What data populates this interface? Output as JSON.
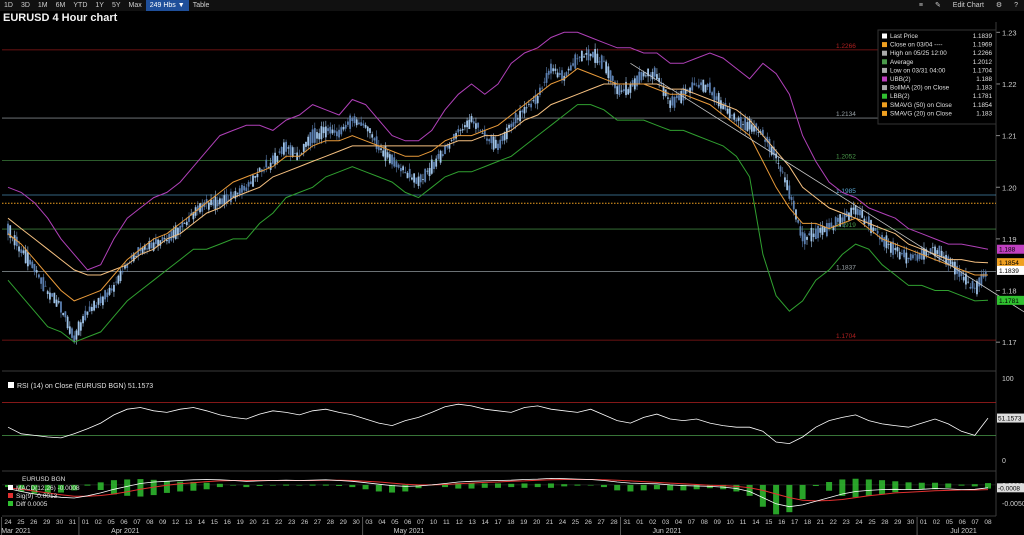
{
  "toolbar": {
    "ranges": [
      "1D",
      "3D",
      "1M",
      "6M",
      "YTD",
      "1Y",
      "5Y",
      "Max"
    ],
    "active_range": "249 Hbs ▼",
    "table_label": "Table",
    "edit_chart_label": "Edit Chart"
  },
  "chart_title": "EURUSD 4 Hour chart",
  "chart_data": [
    {
      "type": "line",
      "subtype": "candlestick-with-bollinger-bands",
      "title": "EURUSD 4 Hour chart",
      "ylim": [
        1.165,
        1.232
      ],
      "y_ticks": [
        "1.23",
        "1.22",
        "1.21",
        "1.20",
        "1.19",
        "1.18",
        "1.17"
      ],
      "x_date_labels": [
        "24",
        "25",
        "26",
        "29",
        "30",
        "31",
        "01",
        "02",
        "05",
        "06",
        "07",
        "08",
        "09",
        "12",
        "13",
        "14",
        "15",
        "16",
        "19",
        "20",
        "21",
        "22",
        "23",
        "26",
        "27",
        "28",
        "29",
        "30",
        "03",
        "04",
        "05",
        "06",
        "07",
        "10",
        "11",
        "12",
        "13",
        "14",
        "17",
        "18",
        "19",
        "20",
        "21",
        "24",
        "25",
        "26",
        "27",
        "28",
        "31",
        "01",
        "02",
        "03",
        "04",
        "07",
        "08",
        "09",
        "10",
        "11",
        "14",
        "15",
        "16",
        "17",
        "18",
        "21",
        "22",
        "23",
        "24",
        "25",
        "28",
        "29",
        "30",
        "01",
        "02",
        "05",
        "06",
        "07",
        "08"
      ],
      "x_month_labels": [
        "Mar 2021",
        "Apr 2021",
        "May 2021",
        "Jun 2021",
        "Jul 2021"
      ],
      "horizontal_levels": [
        {
          "value": 1.2266,
          "label": "1.2266",
          "color": "#b02020"
        },
        {
          "value": 1.2134,
          "label": "1.2134",
          "color": "#9aa3a8"
        },
        {
          "value": 1.2052,
          "label": "1.2052",
          "color": "#4a9a4a"
        },
        {
          "value": 1.1985,
          "label": "1.1985",
          "color": "#5aaad8"
        },
        {
          "value": 1.1919,
          "label": "1.1919",
          "color": "#4a9a4a"
        },
        {
          "value": 1.1837,
          "label": "1.1837",
          "color": "#9aa3a8"
        },
        {
          "value": 1.1704,
          "label": "1.1704",
          "color": "#b02020"
        }
      ],
      "dotted_level": {
        "value": 1.1969,
        "color": "#f0a020"
      },
      "trendline": {
        "from": [
          "16",
          1.224
        ],
        "to": [
          "08",
          1.1705
        ],
        "color": "#c8c8c8"
      },
      "legend": [
        {
          "label": "Last Price",
          "value": "1.1839",
          "color": "#ffffff"
        },
        {
          "label": "Close on 03/04 ----",
          "value": "1.1969",
          "color": "#f0a020"
        },
        {
          "label": "High on 05/25 12:00",
          "value": "1.2266",
          "color": "#aaaaaa"
        },
        {
          "label": "Average",
          "value": "1.2012",
          "color": "#4a9a4a"
        },
        {
          "label": "Low on 03/31 04:00",
          "value": "1.1704",
          "color": "#aaaaaa"
        },
        {
          "label": "UBB(2)",
          "value": "1.188",
          "color": "#c040c0"
        },
        {
          "label": "BollMA (20)  on Close",
          "value": "1.183",
          "color": "#aaaaaa"
        },
        {
          "label": "LBB(2)",
          "value": "1.1781",
          "color": "#30c030"
        },
        {
          "label": "SMAVG (50)  on Close",
          "value": "1.1854",
          "color": "#f0a020"
        },
        {
          "label": "SMAVG (20)  on Close",
          "value": "1.183",
          "color": "#f0a020"
        }
      ],
      "price_tags": [
        {
          "value": 1.188,
          "text": "1.188",
          "color": "#c040c0"
        },
        {
          "value": 1.1854,
          "text": "1.1854",
          "color": "#f0a020"
        },
        {
          "value": 1.1839,
          "text": "1.1839",
          "color": "#ffffff"
        },
        {
          "value": 1.1781,
          "text": "1.1781",
          "color": "#30c030"
        }
      ],
      "series": [
        {
          "name": "Last Price",
          "values": [
            1.192,
            1.188,
            1.184,
            1.18,
            1.177,
            1.171,
            1.176,
            1.178,
            1.181,
            1.185,
            1.188,
            1.189,
            1.19,
            1.192,
            1.195,
            1.197,
            1.197,
            1.198,
            1.2,
            1.203,
            1.205,
            1.208,
            1.206,
            1.21,
            1.211,
            1.21,
            1.213,
            1.212,
            1.208,
            1.205,
            1.203,
            1.201,
            1.204,
            1.207,
            1.211,
            1.213,
            1.21,
            1.208,
            1.212,
            1.215,
            1.217,
            1.223,
            1.221,
            1.225,
            1.226,
            1.224,
            1.219,
            1.219,
            1.222,
            1.222,
            1.216,
            1.218,
            1.22,
            1.219,
            1.216,
            1.213,
            1.212,
            1.21,
            1.206,
            1.199,
            1.19,
            1.191,
            1.192,
            1.194,
            1.196,
            1.193,
            1.19,
            1.188,
            1.186,
            1.187,
            1.188,
            1.186,
            1.183,
            1.18,
            1.1839
          ]
        },
        {
          "name": "SMAVG (20)  on Close",
          "values": [
            1.191,
            1.189,
            1.186,
            1.183,
            1.18,
            1.178,
            1.179,
            1.18,
            1.183,
            1.186,
            1.188,
            1.19,
            1.191,
            1.193,
            1.195,
            1.197,
            1.199,
            1.201,
            1.202,
            1.203,
            1.204,
            1.206,
            1.206,
            1.208,
            1.209,
            1.209,
            1.21,
            1.209,
            1.208,
            1.207,
            1.206,
            1.206,
            1.207,
            1.209,
            1.21,
            1.21,
            1.211,
            1.212,
            1.214,
            1.216,
            1.218,
            1.22,
            1.221,
            1.223,
            1.222,
            1.221,
            1.22,
            1.22,
            1.22,
            1.219,
            1.218,
            1.218,
            1.217,
            1.216,
            1.214,
            1.212,
            1.21,
            1.205,
            1.2,
            1.196,
            1.193,
            1.193,
            1.192,
            1.193,
            1.194,
            1.192,
            1.19,
            1.189,
            1.188,
            1.187,
            1.186,
            1.185,
            1.184,
            1.183,
            1.183
          ]
        },
        {
          "name": "SMAVG (50)  on Close",
          "values": [
            1.194,
            1.192,
            1.19,
            1.188,
            1.186,
            1.184,
            1.183,
            1.183,
            1.184,
            1.185,
            1.187,
            1.188,
            1.19,
            1.191,
            1.193,
            1.195,
            1.196,
            1.198,
            1.199,
            1.2,
            1.202,
            1.203,
            1.204,
            1.205,
            1.206,
            1.207,
            1.208,
            1.208,
            1.208,
            1.208,
            1.208,
            1.208,
            1.208,
            1.208,
            1.209,
            1.209,
            1.21,
            1.21,
            1.211,
            1.213,
            1.214,
            1.216,
            1.217,
            1.218,
            1.219,
            1.22,
            1.22,
            1.22,
            1.22,
            1.22,
            1.219,
            1.219,
            1.218,
            1.217,
            1.216,
            1.215,
            1.213,
            1.21,
            1.207,
            1.204,
            1.2,
            1.198,
            1.196,
            1.195,
            1.194,
            1.193,
            1.192,
            1.191,
            1.189,
            1.188,
            1.187,
            1.186,
            1.186,
            1.1855,
            1.1854
          ]
        },
        {
          "name": "UBB(2)",
          "values": [
            1.2,
            1.199,
            1.197,
            1.194,
            1.19,
            1.187,
            1.184,
            1.185,
            1.19,
            1.194,
            1.196,
            1.198,
            1.199,
            1.201,
            1.204,
            1.207,
            1.21,
            1.211,
            1.212,
            1.212,
            1.211,
            1.213,
            1.214,
            1.216,
            1.215,
            1.214,
            1.217,
            1.216,
            1.213,
            1.21,
            1.209,
            1.209,
            1.211,
            1.215,
            1.218,
            1.22,
            1.218,
            1.22,
            1.224,
            1.226,
            1.227,
            1.229,
            1.23,
            1.23,
            1.229,
            1.228,
            1.227,
            1.227,
            1.226,
            1.226,
            1.224,
            1.224,
            1.225,
            1.226,
            1.225,
            1.223,
            1.221,
            1.224,
            1.222,
            1.218,
            1.21,
            1.205,
            1.201,
            1.199,
            1.198,
            1.196,
            1.195,
            1.194,
            1.192,
            1.191,
            1.19,
            1.189,
            1.189,
            1.1885,
            1.188
          ]
        },
        {
          "name": "LBB(2)",
          "values": [
            1.182,
            1.179,
            1.176,
            1.173,
            1.172,
            1.17,
            1.171,
            1.172,
            1.175,
            1.178,
            1.18,
            1.182,
            1.184,
            1.186,
            1.188,
            1.188,
            1.189,
            1.19,
            1.19,
            1.193,
            1.195,
            1.198,
            1.199,
            1.2,
            1.202,
            1.203,
            1.204,
            1.203,
            1.202,
            1.201,
            1.199,
            1.198,
            1.2,
            1.202,
            1.203,
            1.203,
            1.204,
            1.205,
            1.206,
            1.208,
            1.21,
            1.212,
            1.214,
            1.216,
            1.216,
            1.215,
            1.213,
            1.213,
            1.213,
            1.212,
            1.211,
            1.211,
            1.21,
            1.209,
            1.208,
            1.206,
            1.202,
            1.187,
            1.179,
            1.176,
            1.178,
            1.182,
            1.184,
            1.187,
            1.189,
            1.188,
            1.185,
            1.183,
            1.181,
            1.181,
            1.18,
            1.18,
            1.179,
            1.178,
            1.1781
          ]
        }
      ]
    },
    {
      "type": "line",
      "title": "RSI (14)  on Close (EURUSD BGN) 51.1573",
      "ylim": [
        0,
        100
      ],
      "y_ticks": [
        "100",
        "50",
        "0"
      ],
      "overbought": 70,
      "oversold": 30,
      "last_value": "51.1573",
      "series": [
        {
          "name": "RSI (14)",
          "values": [
            40,
            32,
            30,
            28,
            27,
            32,
            38,
            45,
            55,
            62,
            64,
            60,
            58,
            62,
            64,
            60,
            55,
            52,
            50,
            56,
            60,
            58,
            55,
            60,
            62,
            58,
            55,
            50,
            45,
            42,
            48,
            52,
            58,
            65,
            68,
            66,
            62,
            60,
            58,
            64,
            66,
            62,
            60,
            58,
            62,
            55,
            48,
            45,
            52,
            56,
            50,
            48,
            50,
            45,
            42,
            40,
            40,
            35,
            22,
            20,
            28,
            40,
            48,
            52,
            55,
            48,
            44,
            42,
            40,
            45,
            50,
            44,
            35,
            30,
            51.1573
          ]
        }
      ]
    },
    {
      "type": "line",
      "title": "EURUSD BGN",
      "y_ticks": [
        "0.0000",
        "-0.0050"
      ],
      "ylim": [
        -0.008,
        0.003
      ],
      "legend": [
        {
          "label": "MACD(12,26)",
          "value": "-0.0008",
          "color": "#ffffff"
        },
        {
          "label": "Sig(9)",
          "value": "-0.0013",
          "color": "#e03030"
        },
        {
          "label": "Diff",
          "value": "0.0005",
          "color": "#30c030"
        }
      ],
      "last_value": "-0.0008",
      "series": [
        {
          "name": "MACD(12,26)",
          "values": [
            -0.001,
            -0.0018,
            -0.0025,
            -0.003,
            -0.0034,
            -0.0036,
            -0.003,
            -0.0022,
            -0.0012,
            -0.0004,
            0.0004,
            0.0008,
            0.001,
            0.0012,
            0.0014,
            0.0015,
            0.0014,
            0.0012,
            0.001,
            0.0011,
            0.0012,
            0.0013,
            0.0012,
            0.0013,
            0.0014,
            0.0012,
            0.001,
            0.0006,
            0.0002,
            -0.0002,
            -0.0004,
            -0.0003,
            0.0,
            0.0004,
            0.0008,
            0.001,
            0.0011,
            0.0012,
            0.0013,
            0.0015,
            0.0016,
            0.0018,
            0.0017,
            0.0016,
            0.0015,
            0.0012,
            0.0008,
            0.0005,
            0.0004,
            0.0003,
            0.0,
            -0.0002,
            -0.0003,
            -0.0004,
            -0.0006,
            -0.001,
            -0.0018,
            -0.0035,
            -0.0052,
            -0.006,
            -0.0055,
            -0.0045,
            -0.0035,
            -0.0025,
            -0.0018,
            -0.0015,
            -0.0013,
            -0.0012,
            -0.0013,
            -0.0012,
            -0.001,
            -0.0011,
            -0.0013,
            -0.0012,
            -0.0008
          ]
        },
        {
          "name": "Sig(9)",
          "values": [
            -0.0008,
            -0.0012,
            -0.0017,
            -0.0022,
            -0.0027,
            -0.0031,
            -0.0031,
            -0.0029,
            -0.0025,
            -0.0019,
            -0.0012,
            -0.0006,
            -0.0001,
            0.0003,
            0.0006,
            0.0009,
            0.0011,
            0.0012,
            0.0012,
            0.0012,
            0.0012,
            0.0012,
            0.0012,
            0.0012,
            0.0013,
            0.0013,
            0.0012,
            0.001,
            0.0008,
            0.0005,
            0.0002,
            0.0,
            0.0,
            0.0001,
            0.0003,
            0.0005,
            0.0007,
            0.0008,
            0.001,
            0.0011,
            0.0013,
            0.0014,
            0.0015,
            0.0015,
            0.0015,
            0.0014,
            0.0013,
            0.0011,
            0.0009,
            0.0007,
            0.0005,
            0.0003,
            0.0001,
            -0.0001,
            -0.0002,
            -0.0004,
            -0.0008,
            -0.0015,
            -0.0025,
            -0.0035,
            -0.0042,
            -0.0044,
            -0.0043,
            -0.004,
            -0.0035,
            -0.003,
            -0.0026,
            -0.0022,
            -0.002,
            -0.0018,
            -0.0016,
            -0.0015,
            -0.0014,
            -0.0014,
            -0.0013
          ]
        }
      ]
    }
  ],
  "colors": {
    "background": "#000000",
    "bull": "#9fc3e8",
    "bear": "#5b7fb0",
    "bb_upper": "#b040b8",
    "bb_lower": "#30a030",
    "sma20": "#e89a3a",
    "sma50": "#f5c080",
    "rsi_line": "#ffffff",
    "macd": "#ffffff",
    "signal": "#e03030",
    "diff": "#30c030"
  },
  "icons": {
    "menu": "hamburger-icon",
    "edit": "pencil-icon",
    "settings": "gear-icon",
    "help": "question-icon"
  }
}
